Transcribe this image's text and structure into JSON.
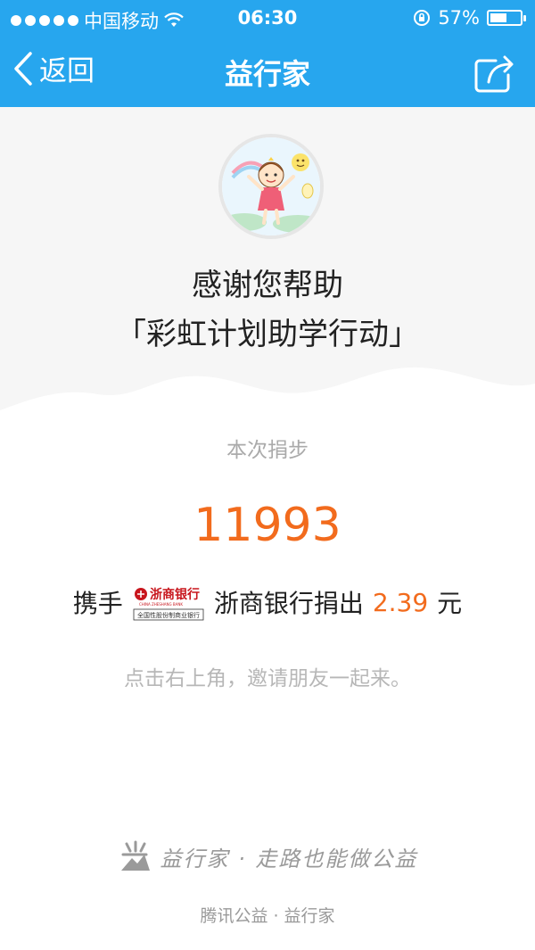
{
  "status_bar": {
    "carrier": "中国移动",
    "time": "06:30",
    "battery_percent_text": "57%",
    "battery_level": 0.57
  },
  "nav": {
    "back_label": "返回",
    "title": "益行家"
  },
  "hero": {
    "thanks_line1": "感谢您帮助",
    "project_name": "「彩虹计划助学行动」"
  },
  "donation": {
    "steps_label": "本次捐步",
    "steps_value": "11993",
    "prefix": "携手",
    "bank_logo_text": "浙商银行",
    "bank_logo_sub": "全国性股份制商业银行",
    "sponsor_text": "浙商银行捐出",
    "amount": "2.39",
    "unit": "元",
    "invite_text": "点击右上角，邀请朋友一起来。"
  },
  "footer": {
    "slogan": "益行家 · 走路也能做公益",
    "credit": "腾讯公益 · 益行家"
  },
  "colors": {
    "brand_blue": "#27a6ee",
    "accent_orange": "#f26b1d",
    "hero_bg": "#f6f6f6"
  },
  "icons": [
    "wifi-icon",
    "rotation-lock-icon",
    "battery-icon",
    "back-chevron-icon",
    "share-icon",
    "avatar-illustration",
    "bank-logo-icon",
    "yixingjia-logo-icon"
  ]
}
